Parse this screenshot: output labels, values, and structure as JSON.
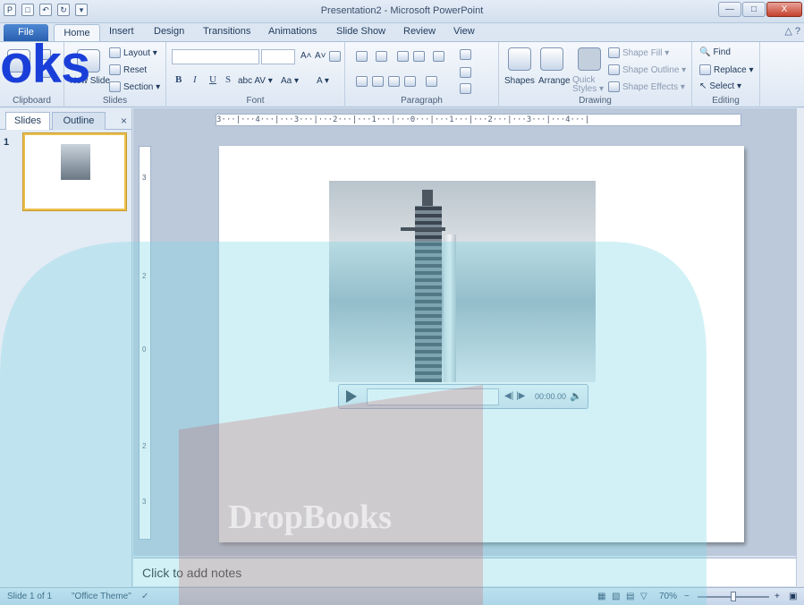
{
  "window": {
    "title": "Presentation2 - Microsoft PowerPoint",
    "qat_icons": [
      "app-icon",
      "save-icon",
      "undo-icon",
      "redo-icon",
      "customize-icon"
    ],
    "controls": {
      "minimize": "—",
      "maximize": "□",
      "close": "X"
    }
  },
  "tabs": {
    "file": "File",
    "home": "Home",
    "items": [
      "Insert",
      "Design",
      "Transitions",
      "Animations",
      "Slide Show",
      "Review",
      "View"
    ],
    "help": "△ ?"
  },
  "ribbon": {
    "clipboard": {
      "label": "Clipboard"
    },
    "slides": {
      "new_slide": "New Slide",
      "layout": "Layout ▾",
      "reset": "Reset",
      "section": "Section ▾",
      "label": "Slides"
    },
    "font": {
      "grow": "A˄",
      "shrink": "A˅",
      "bold": "B",
      "italic": "I",
      "underline": "U",
      "strike": "S",
      "spacing": "abc  AV ▾",
      "case": "Aa ▾",
      "color": "A ▾",
      "label": "Font"
    },
    "paragraph": {
      "label": "Paragraph"
    },
    "drawing": {
      "shapes": "Shapes",
      "arrange": "Arrange",
      "quick_styles": "Quick Styles ▾",
      "shape_fill": "Shape Fill ▾",
      "shape_outline": "Shape Outline ▾",
      "shape_effects": "Shape Effects ▾",
      "label": "Drawing"
    },
    "editing": {
      "find": "Find",
      "replace": "Replace ▾",
      "select": "Select ▾",
      "label": "Editing"
    }
  },
  "left_panel": {
    "tab_slides": "Slides",
    "tab_outline": "Outline",
    "close": "×",
    "slide_number": "1"
  },
  "rulers": {
    "top": "3···|···4···|···3···|···2···|···1···|···0···|···1···|···2···|···3···|···4···|",
    "left_ticks": [
      "3",
      "2",
      "0",
      "2",
      "3"
    ]
  },
  "media_player": {
    "time": "00:00.00",
    "step_buttons": "◀| |▶"
  },
  "notes": {
    "placeholder": "Click to add notes"
  },
  "statusbar": {
    "slide_info": "Slide 1 of 1",
    "theme": "\"Office Theme\"",
    "zoom": "70%",
    "zoom_out": "−",
    "zoom_in": "+"
  },
  "watermark": {
    "text": "DropBooks",
    "overlay_text": "oks"
  }
}
